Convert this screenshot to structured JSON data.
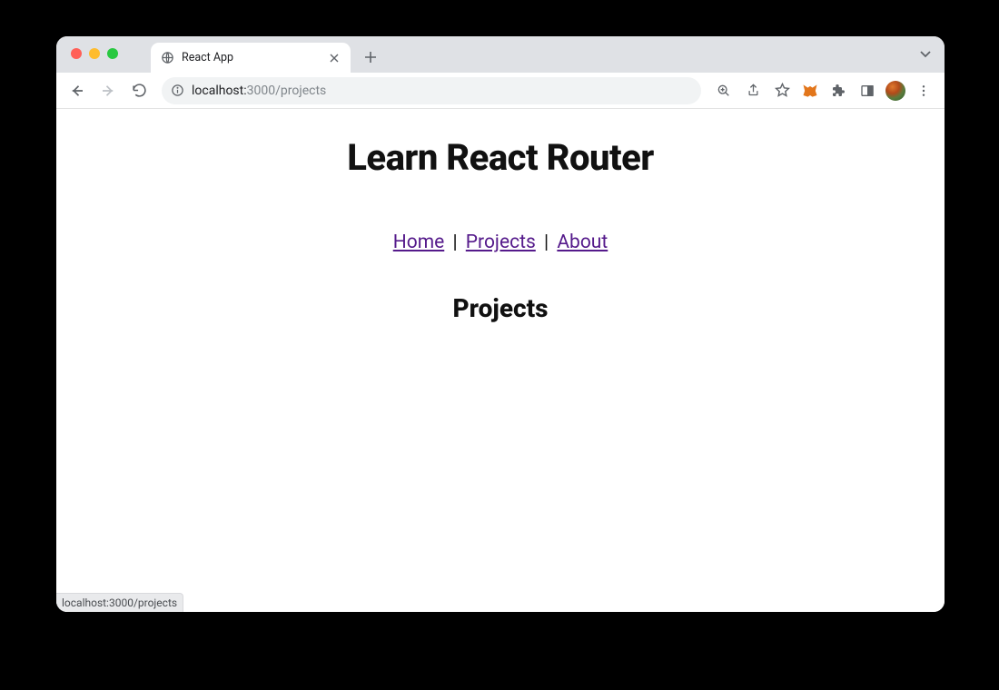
{
  "browser": {
    "tab_title": "React App",
    "url_host": "localhost:",
    "url_path": "3000/projects",
    "status_text": "localhost:3000/projects"
  },
  "page": {
    "heading": "Learn React Router",
    "nav": {
      "home": "Home",
      "projects": "Projects",
      "about": "About",
      "separator": " | "
    },
    "subheading": "Projects"
  }
}
